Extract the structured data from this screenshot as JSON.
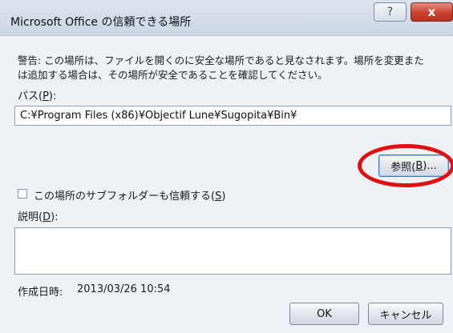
{
  "dialog": {
    "title": "Microsoft Office の信頼できる場所",
    "help_glyph": "?",
    "close_glyph": "x",
    "warning_line1": "警告: この場所は、ファイルを開くのに安全な場所であると見なされます。場所を変更また",
    "warning_line2": "は追加する場合は、その場所が安全であることを確認してください。",
    "path_label_prefix": "パス(",
    "path_label_key": "P",
    "path_label_suffix": "):",
    "path_value": "C:¥Program Files (x86)¥Objectif Lune¥Sugopita¥Bin¥",
    "browse_prefix": "参照(",
    "browse_key": "B",
    "browse_suffix": ")...",
    "subfolder_prefix": "この場所のサブフォルダーも信頼する(",
    "subfolder_key": "S",
    "subfolder_suffix": ")",
    "subfolder_checked": false,
    "description_prefix": "説明(",
    "description_key": "D",
    "description_suffix": "):",
    "description_value": "",
    "created_label": "作成日時:",
    "created_value": "2013/03/26 10:54",
    "ok_label": "OK",
    "cancel_label": "キャンセル"
  },
  "colors": {
    "highlight_ring": "#e01010",
    "close_button": "#c8432f",
    "dialog_background": "#eef1f6"
  }
}
